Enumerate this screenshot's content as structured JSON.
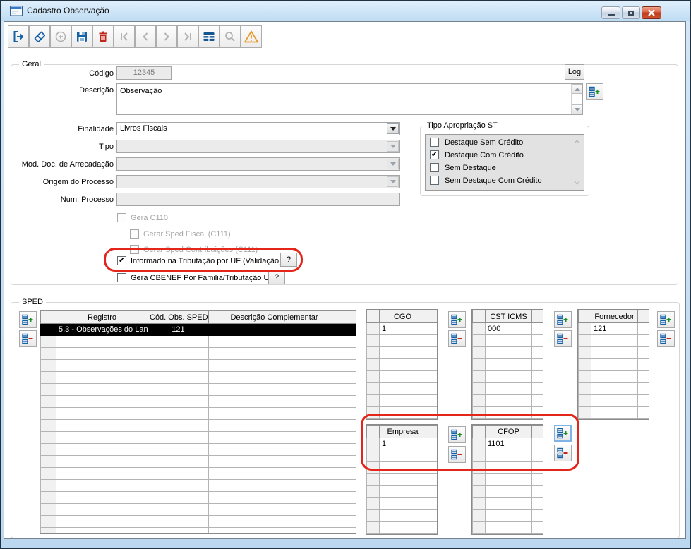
{
  "window": {
    "title": "Cadastro Observação"
  },
  "toolbar": {
    "buttons": [
      "exit",
      "clear",
      "add",
      "save",
      "delete",
      "nav-first",
      "nav-prior",
      "nav-next",
      "nav-last",
      "grid",
      "search",
      "warning"
    ]
  },
  "geral": {
    "legend": "Geral",
    "codigo_label": "Código",
    "codigo_value": "12345",
    "log_button": "Log",
    "descricao_label": "Descrição",
    "descricao_value": "Observação",
    "finalidade_label": "Finalidade",
    "finalidade_value": "Livros Fiscais",
    "tipo_label": "Tipo",
    "mod_doc_label": "Mod. Doc. de Arrecadação",
    "origem_label": "Origem do Processo",
    "num_processo_label": "Num. Processo",
    "tipo_aprop": {
      "legend": "Tipo Apropriação ST",
      "items": [
        {
          "label": "Destaque Sem Crédito",
          "glyph": ""
        },
        {
          "label": "Destaque Com Crédito",
          "glyph": "✔"
        },
        {
          "label": "Sem Destaque",
          "glyph": ""
        },
        {
          "label": "Sem Destaque Com Crédito",
          "glyph": ""
        }
      ]
    },
    "checks": [
      {
        "label": "Gera C110",
        "glyph": ""
      },
      {
        "label": "Gerar Sped Fiscal (C111)",
        "glyph": ""
      },
      {
        "label": "Gerar Sped Contribuições (C111)",
        "glyph": ""
      },
      {
        "label": "Informado na Tributação por UF (Validação)",
        "glyph": "✔",
        "help": "?"
      },
      {
        "label": "Gera CBENEF Por Familia/Tributação UF",
        "glyph": "",
        "help": "?"
      }
    ]
  },
  "sped": {
    "legend": "SPED",
    "main": {
      "col_registro": "Registro",
      "col_cod": "Cód. Obs. SPED",
      "col_desc": "Descrição Complementar",
      "row0": {
        "registro": "5.3 - Observações do Lan",
        "cod": "121",
        "desc": ""
      }
    },
    "cgo": {
      "header": "CGO",
      "value": "1"
    },
    "cst": {
      "header": "CST ICMS",
      "value": "000"
    },
    "fornecedor": {
      "header": "Fornecedor",
      "value": "121"
    },
    "empresa": {
      "header": "Empresa",
      "value": "1"
    },
    "cfop": {
      "header": "CFOP",
      "value": "1101"
    }
  },
  "colors": {
    "annotation": "#E3251B",
    "icon_blue": "#1660A5",
    "icon_red": "#C2271C",
    "icon_amber": "#E79B2F",
    "selected_row_bg": "#000000"
  }
}
